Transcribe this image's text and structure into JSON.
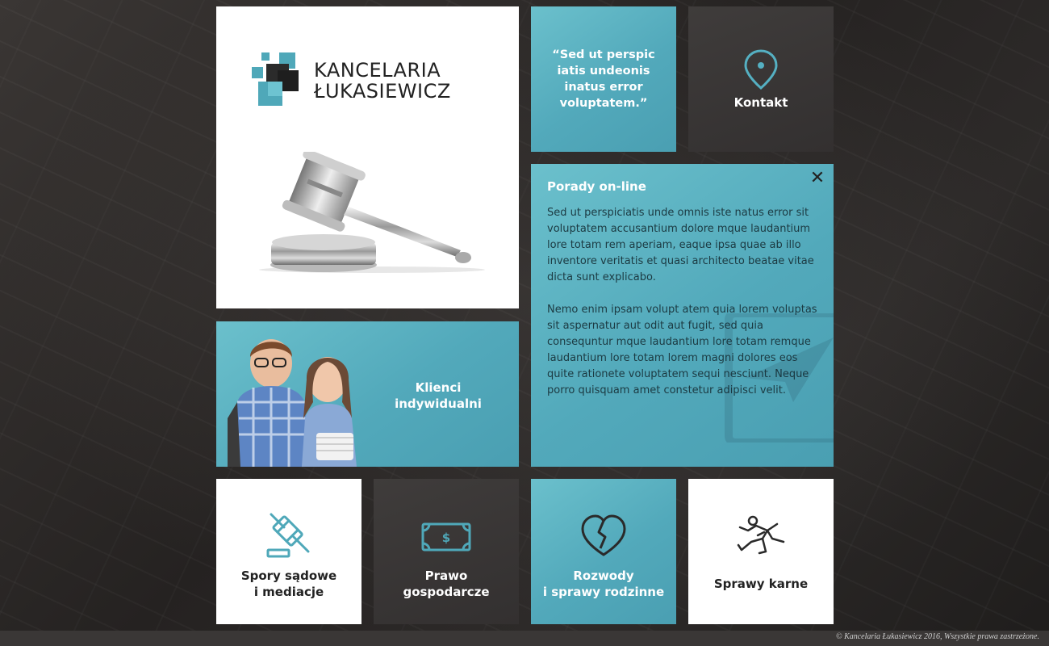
{
  "brand": {
    "name_line1": "KANCELARIA",
    "name_line2": "ŁUKASIEWICZ"
  },
  "tiles": {
    "quote": "“Sed ut perspic iatis undeonis inatus error voluptatem.”",
    "kontakt": {
      "label": "Kontakt",
      "icon": "map-pin-icon"
    },
    "porady": {
      "title": "Porady on-line",
      "paragraph1": "Sed ut perspiciatis unde omnis iste natus error sit voluptatem accusantium dolore mque laudantium lore totam rem aperiam, eaque ipsa quae ab illo inventore veritatis et quasi architecto beatae vitae dicta sunt explicabo.",
      "paragraph2": "Nemo enim ipsam volupt atem quia lorem voluptas sit aspernatur aut odit aut fugit, sed quia consequntur mque laudantium lore totam remque laudantium lore totam lorem magni dolores eos quite rationete voluptatem sequi nesciunt. Neque porro quisquam amet constetur adipisci velit.",
      "close_icon": "close-icon"
    },
    "klienci": {
      "line1": "Klienci",
      "line2": "indywidualni"
    },
    "spory": {
      "line1": "Spory sądowe",
      "line2": "i  mediacje",
      "icon": "gavel-icon"
    },
    "prawo": {
      "line1": "Prawo",
      "line2": "gospodarcze",
      "icon": "banknote-icon"
    },
    "rozwody": {
      "line1": "Rozwody",
      "line2": "i sprawy rodzinne",
      "icon": "broken-heart-icon"
    },
    "karne": {
      "label": "Sprawy karne",
      "icon": "crime-scene-icon"
    }
  },
  "footer": {
    "copyright": "© Kancelaria Łukasiewicz 2016, Wszystkie prawa zastrzeżone."
  },
  "colors": {
    "teal": "#52a9bb",
    "dark_tile": "#3a3736",
    "accent_icon": "#4a9fb2",
    "background": "#2b2827"
  }
}
